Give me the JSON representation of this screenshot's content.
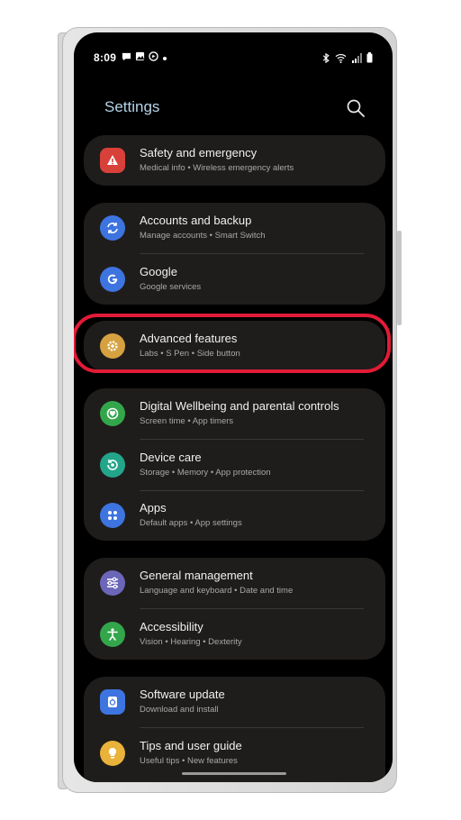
{
  "status": {
    "time": "8:09",
    "left_icons": [
      "chat-icon",
      "gallery-icon",
      "nav-icon",
      "dot-icon"
    ],
    "right_icons": [
      "bluetooth-icon",
      "wifi-icon",
      "signal-icon",
      "battery-icon"
    ]
  },
  "page_title": "Settings",
  "groups": [
    {
      "items": [
        {
          "title": "Safety and emergency",
          "subtitle": "Medical info • Wireless emergency alerts",
          "icon": "safety-icon",
          "color": "#d8403a"
        }
      ]
    },
    {
      "items": [
        {
          "title": "Accounts and backup",
          "subtitle": "Manage accounts • Smart Switch",
          "icon": "sync-icon",
          "color": "#3d74e0"
        },
        {
          "title": "Google",
          "subtitle": "Google services",
          "icon": "google-icon",
          "color": "#3d74e0"
        }
      ]
    },
    {
      "items": [
        {
          "title": "Advanced features",
          "subtitle": "Labs • S Pen • Side button",
          "icon": "gear-plus-icon",
          "color": "#d6a241"
        }
      ]
    },
    {
      "items": [
        {
          "title": "Digital Wellbeing and parental controls",
          "subtitle": "Screen time • App timers",
          "icon": "wellbeing-icon",
          "color": "#33a64b"
        },
        {
          "title": "Device care",
          "subtitle": "Storage • Memory • App protection",
          "icon": "device-care-icon",
          "color": "#23a58a"
        },
        {
          "title": "Apps",
          "subtitle": "Default apps • App settings",
          "icon": "apps-icon",
          "color": "#3d74e0"
        }
      ]
    },
    {
      "items": [
        {
          "title": "General management",
          "subtitle": "Language and keyboard • Date and time",
          "icon": "sliders-icon",
          "color": "#6b66b8"
        },
        {
          "title": "Accessibility",
          "subtitle": "Vision • Hearing • Dexterity",
          "icon": "accessibility-icon",
          "color": "#33a64b"
        }
      ]
    },
    {
      "items": [
        {
          "title": "Software update",
          "subtitle": "Download and install",
          "icon": "update-icon",
          "color": "#3d74e0"
        },
        {
          "title": "Tips and user guide",
          "subtitle": "Useful tips • New features",
          "icon": "bulb-icon",
          "color": "#e9b23a"
        }
      ]
    }
  ],
  "highlighted_item": "Advanced features",
  "highlight_color": "#e21b37"
}
